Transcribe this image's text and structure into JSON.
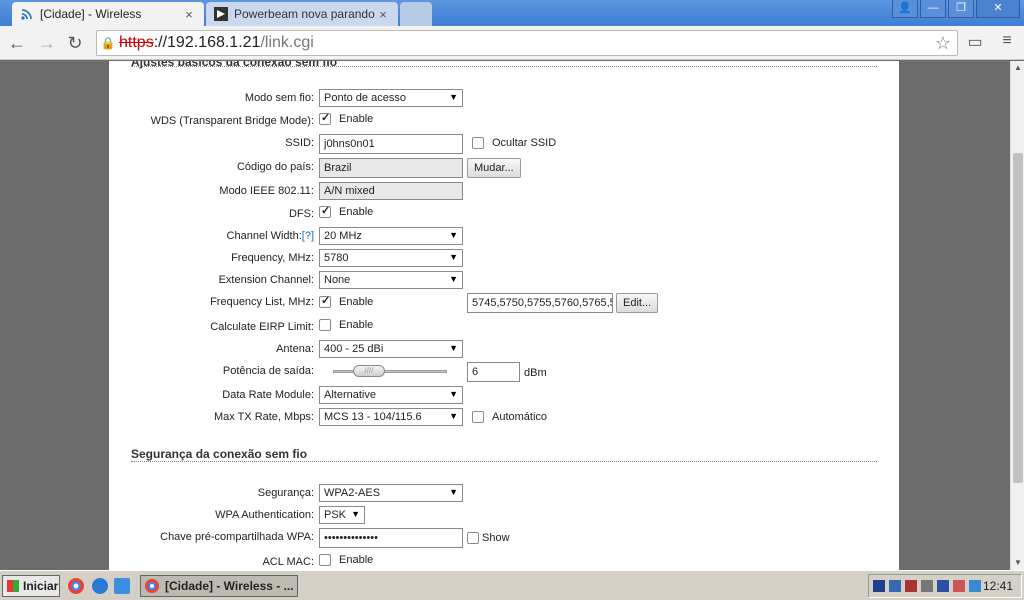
{
  "browser": {
    "tabs": [
      {
        "title": "[Cidade] - Wireless",
        "close": "×"
      },
      {
        "title": "Powerbeam nova parando - F",
        "close": "×"
      }
    ],
    "window_buttons": {
      "user": "👤",
      "minimize": "—",
      "restore": "❐",
      "close": "✕"
    },
    "url": {
      "scheme": "https",
      "host": "://192.168.1.21",
      "path": "/link.cgi"
    }
  },
  "section_basic": {
    "title": "Ajustes básicos da conexão sem fio"
  },
  "form": {
    "modo": {
      "label": "Modo sem fio:",
      "value": "Ponto de acesso"
    },
    "wds": {
      "label": "WDS (Transparent Bridge Mode):",
      "checkbox": "Enable",
      "checked": true
    },
    "ssid": {
      "label": "SSID:",
      "value": "j0hns0n01",
      "hide_label": "Ocultar SSID"
    },
    "country": {
      "label": "Código do país:",
      "value": "Brazil",
      "button": "Mudar..."
    },
    "ieee": {
      "label": "Modo IEEE 802.11:",
      "value": "A/N mixed"
    },
    "dfs": {
      "label": "DFS:",
      "checkbox": "Enable",
      "checked": true
    },
    "channel_width": {
      "label": "Channel Width:",
      "help": "[?]",
      "value": "20 MHz"
    },
    "frequency": {
      "label": "Frequency, MHz:",
      "value": "5780"
    },
    "ext_channel": {
      "label": "Extension Channel:",
      "value": "None"
    },
    "freq_list": {
      "label": "Frequency List, MHz:",
      "checkbox": "Enable",
      "checked": true,
      "value": "5745,5750,5755,5760,5765,5",
      "button": "Edit..."
    },
    "eirp": {
      "label": "Calculate EIRP Limit:",
      "checkbox": "Enable",
      "checked": false
    },
    "antena": {
      "label": "Antena:",
      "value": "400 - 25 dBi"
    },
    "power": {
      "label": "Potência de saída:",
      "value": "6",
      "unit": "dBm",
      "slider_level": 0.2
    },
    "data_rate": {
      "label": "Data Rate Module:",
      "value": "Alternative"
    },
    "max_tx": {
      "label": "Max TX Rate, Mbps:",
      "value": "MCS 13 - 104/115.6",
      "auto_label": "Automático"
    }
  },
  "section_security": {
    "title": "Segurança da conexão sem fio"
  },
  "security": {
    "seguranca": {
      "label": "Segurança:",
      "value": "WPA2-AES"
    },
    "wpa_auth": {
      "label": "WPA Authentication:",
      "value": "PSK"
    },
    "psk": {
      "label": "Chave pré-compartilhada WPA:",
      "value": "••••••••••••••",
      "show_label": "Show"
    },
    "acl": {
      "label": "ACL MAC:",
      "checkbox": "Enable",
      "checked": false
    }
  },
  "taskbar": {
    "start": "Iniciar",
    "task": "[Cidade] - Wireless - ...",
    "clock": "12:41"
  }
}
